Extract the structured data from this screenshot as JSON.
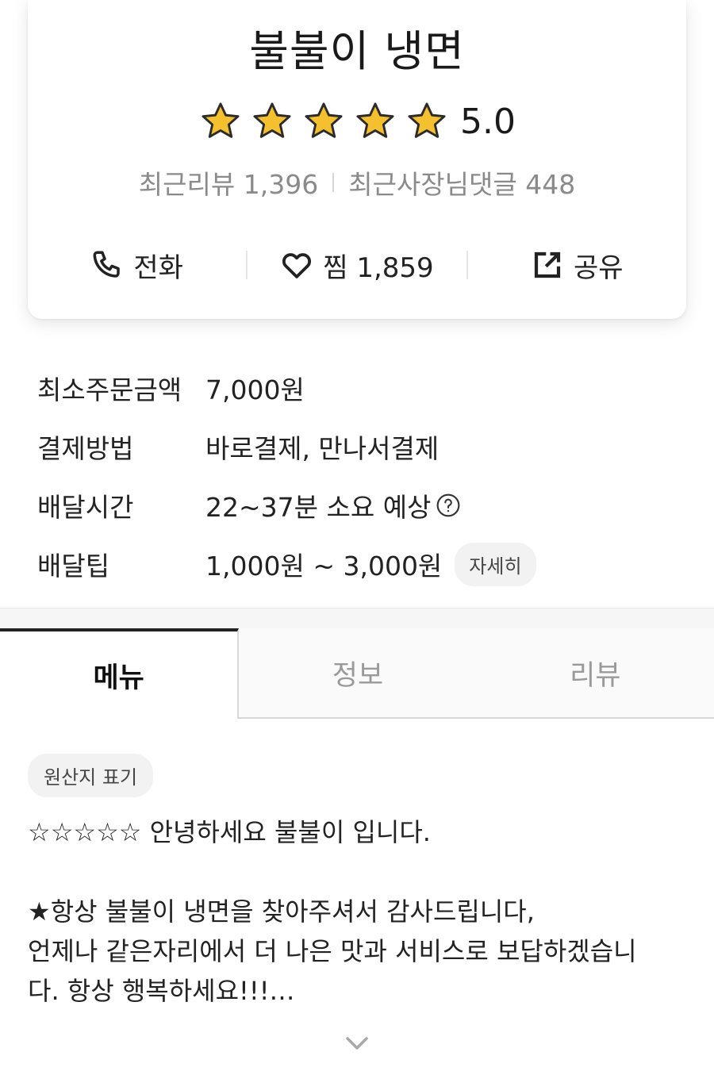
{
  "store": {
    "name": "불불이 냉면",
    "rating": "5.0",
    "star_count": 5,
    "star_color": "#F5C02E",
    "recent_reviews_label": "최근리뷰 1,396",
    "owner_replies_label": "최근사장님댓글 448"
  },
  "actions": {
    "call": {
      "icon": "phone-icon",
      "label": "전화"
    },
    "like": {
      "icon": "heart-icon",
      "label": "찜 1,859"
    },
    "share": {
      "icon": "share-icon",
      "label": "공유"
    }
  },
  "info": {
    "min_order": {
      "label": "최소주문금액",
      "value": "7,000원"
    },
    "payment": {
      "label": "결제방법",
      "value": "바로결제, 만나서결제"
    },
    "delivery_time": {
      "label": "배달시간",
      "value": "22~37분 소요 예상",
      "icon": "question-circle-icon"
    },
    "delivery_tip": {
      "label": "배달팁",
      "value": "1,000원 ~ 3,000원",
      "detail_button": "자세히"
    }
  },
  "tabs": [
    {
      "label": "메뉴",
      "active": true
    },
    {
      "label": "정보",
      "active": false
    },
    {
      "label": "리뷰",
      "active": false
    }
  ],
  "notice": {
    "origin_chip": "원산지 표기",
    "line1": "☆☆☆☆☆ 안녕하세요 불불이 입니다.",
    "line2": "★항상 불불이 냉면을 찾아주셔서 감사드립니다,",
    "line3": "언제나 같은자리에서 더 나은 맛과 서비스로 보답하겠습니",
    "line4": "다. 항상 행복하세요!!!…",
    "expand_icon": "chevron-down-icon"
  }
}
